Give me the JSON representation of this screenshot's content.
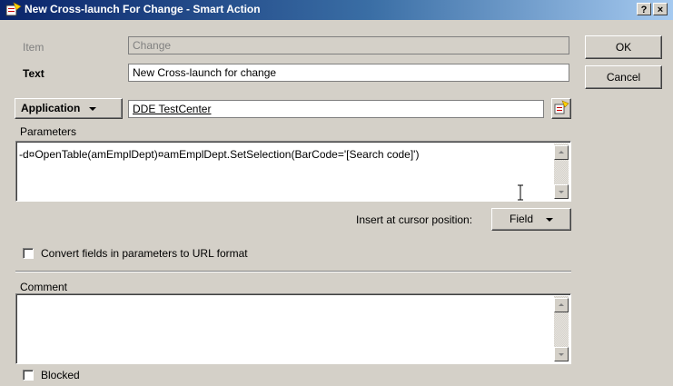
{
  "window": {
    "title": "New Cross-launch For Change - Smart Action",
    "help_button": "?",
    "close_button": "×"
  },
  "item": {
    "label": "Item",
    "value": "Change"
  },
  "text": {
    "label": "Text",
    "value": "New Cross-launch for change"
  },
  "application": {
    "type_label": "Application",
    "value": "DDE TestCenter"
  },
  "parameters": {
    "label": "Parameters",
    "value": "-d¤OpenTable(amEmplDept)¤amEmplDept.SetSelection(BarCode='[Search code]')"
  },
  "insert": {
    "label": "Insert at cursor position:",
    "button_label": "Field"
  },
  "url_format": {
    "label": "Convert fields in parameters to URL format",
    "checked": false
  },
  "comment": {
    "label": "Comment",
    "value": ""
  },
  "blocked": {
    "label": "Blocked",
    "checked": false
  },
  "buttons": {
    "ok": "OK",
    "cancel": "Cancel"
  }
}
